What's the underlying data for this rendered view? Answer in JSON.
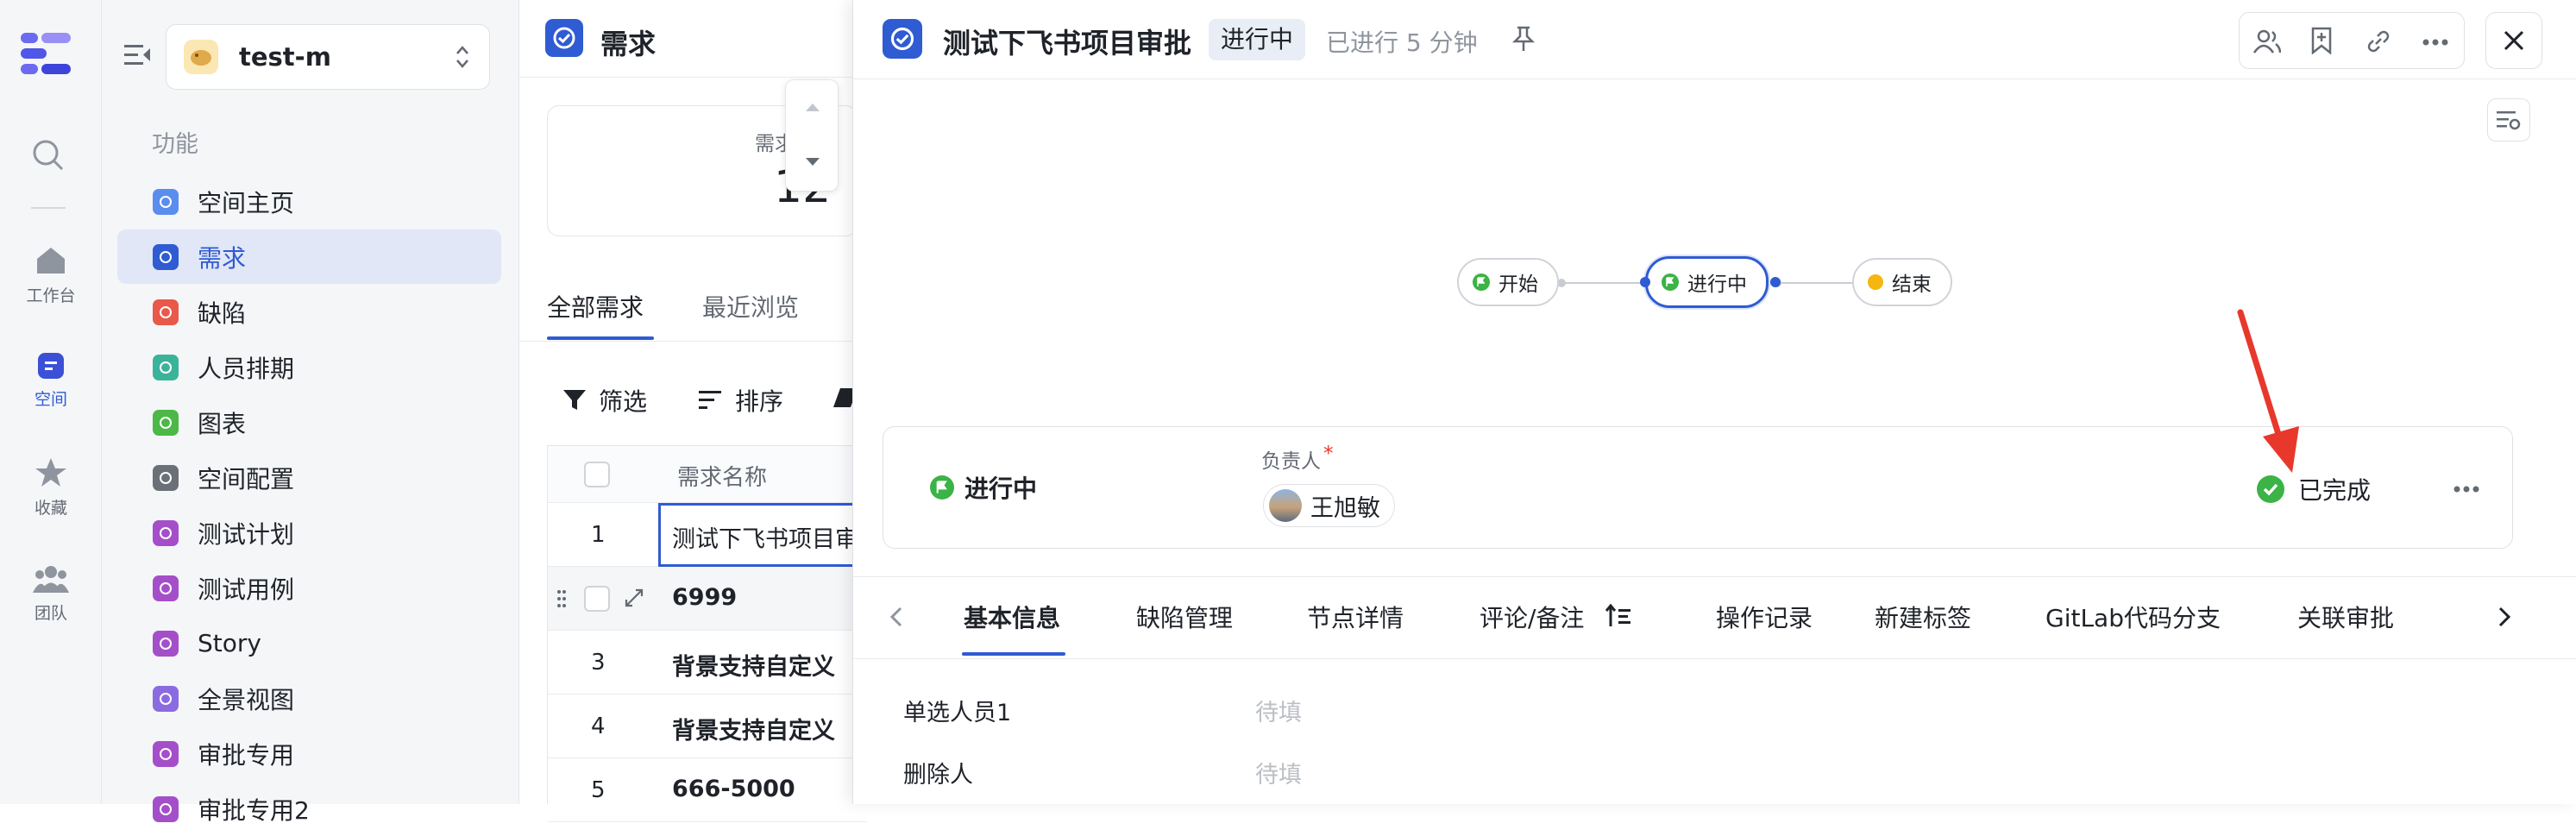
{
  "rail": {
    "workbench": "工作台",
    "space": "空间",
    "favorites": "收藏",
    "team": "团队"
  },
  "sidebar": {
    "space_name": "test-m",
    "section": "功能",
    "items": [
      {
        "label": "空间主页",
        "color": "#5b8def"
      },
      {
        "label": "需求",
        "color": "#2f5bd3"
      },
      {
        "label": "缺陷",
        "color": "#e8594a"
      },
      {
        "label": "人员排期",
        "color": "#3bb39a"
      },
      {
        "label": "图表",
        "color": "#4cb847"
      },
      {
        "label": "空间配置",
        "color": "#6b7078"
      },
      {
        "label": "测试计划",
        "color": "#a44fc9"
      },
      {
        "label": "测试用例",
        "color": "#a44fc9"
      },
      {
        "label": "Story",
        "color": "#a44fc9"
      },
      {
        "label": "全景视图",
        "color": "#8b6be0"
      },
      {
        "label": "审批专用",
        "color": "#a44fc9"
      },
      {
        "label": "审批专用2",
        "color": "#a44fc9"
      }
    ]
  },
  "list": {
    "title": "需求",
    "stat_label": "需求",
    "stat_value": "12",
    "tab_all": "全部需求",
    "tab_recent": "最近浏览",
    "filter": "筛选",
    "sort": "排序",
    "col_name": "需求名称",
    "rows": [
      {
        "num": "1",
        "name": "测试下飞书项目审"
      },
      {
        "num": "",
        "name": "6999"
      },
      {
        "num": "3",
        "name": "背景支持自定义"
      },
      {
        "num": "4",
        "name": "背景支持自定义"
      },
      {
        "num": "5",
        "name": "666-5000"
      }
    ]
  },
  "panel": {
    "title": "测试下飞书项目审批",
    "status": "进行中",
    "elapsed": "已进行 5 分钟",
    "nodes": {
      "start": "开始",
      "progress": "进行中",
      "end": "结束"
    },
    "card": {
      "node_name": "进行中",
      "owner_label": "负责人",
      "required_mark": "*",
      "owner": "王旭敏",
      "done": "已完成"
    },
    "tabs": [
      "基本信息",
      "缺陷管理",
      "节点详情",
      "评论/备注",
      "操作记录",
      "新建标签",
      "GitLab代码分支",
      "关联审批"
    ],
    "fields": [
      {
        "label": "单选人员1",
        "value": "待填"
      },
      {
        "label": "删除人",
        "value": "待填"
      }
    ]
  },
  "colors": {
    "accent": "#2f5bd3",
    "success": "#3bb346",
    "arrow": "#e8382b"
  }
}
